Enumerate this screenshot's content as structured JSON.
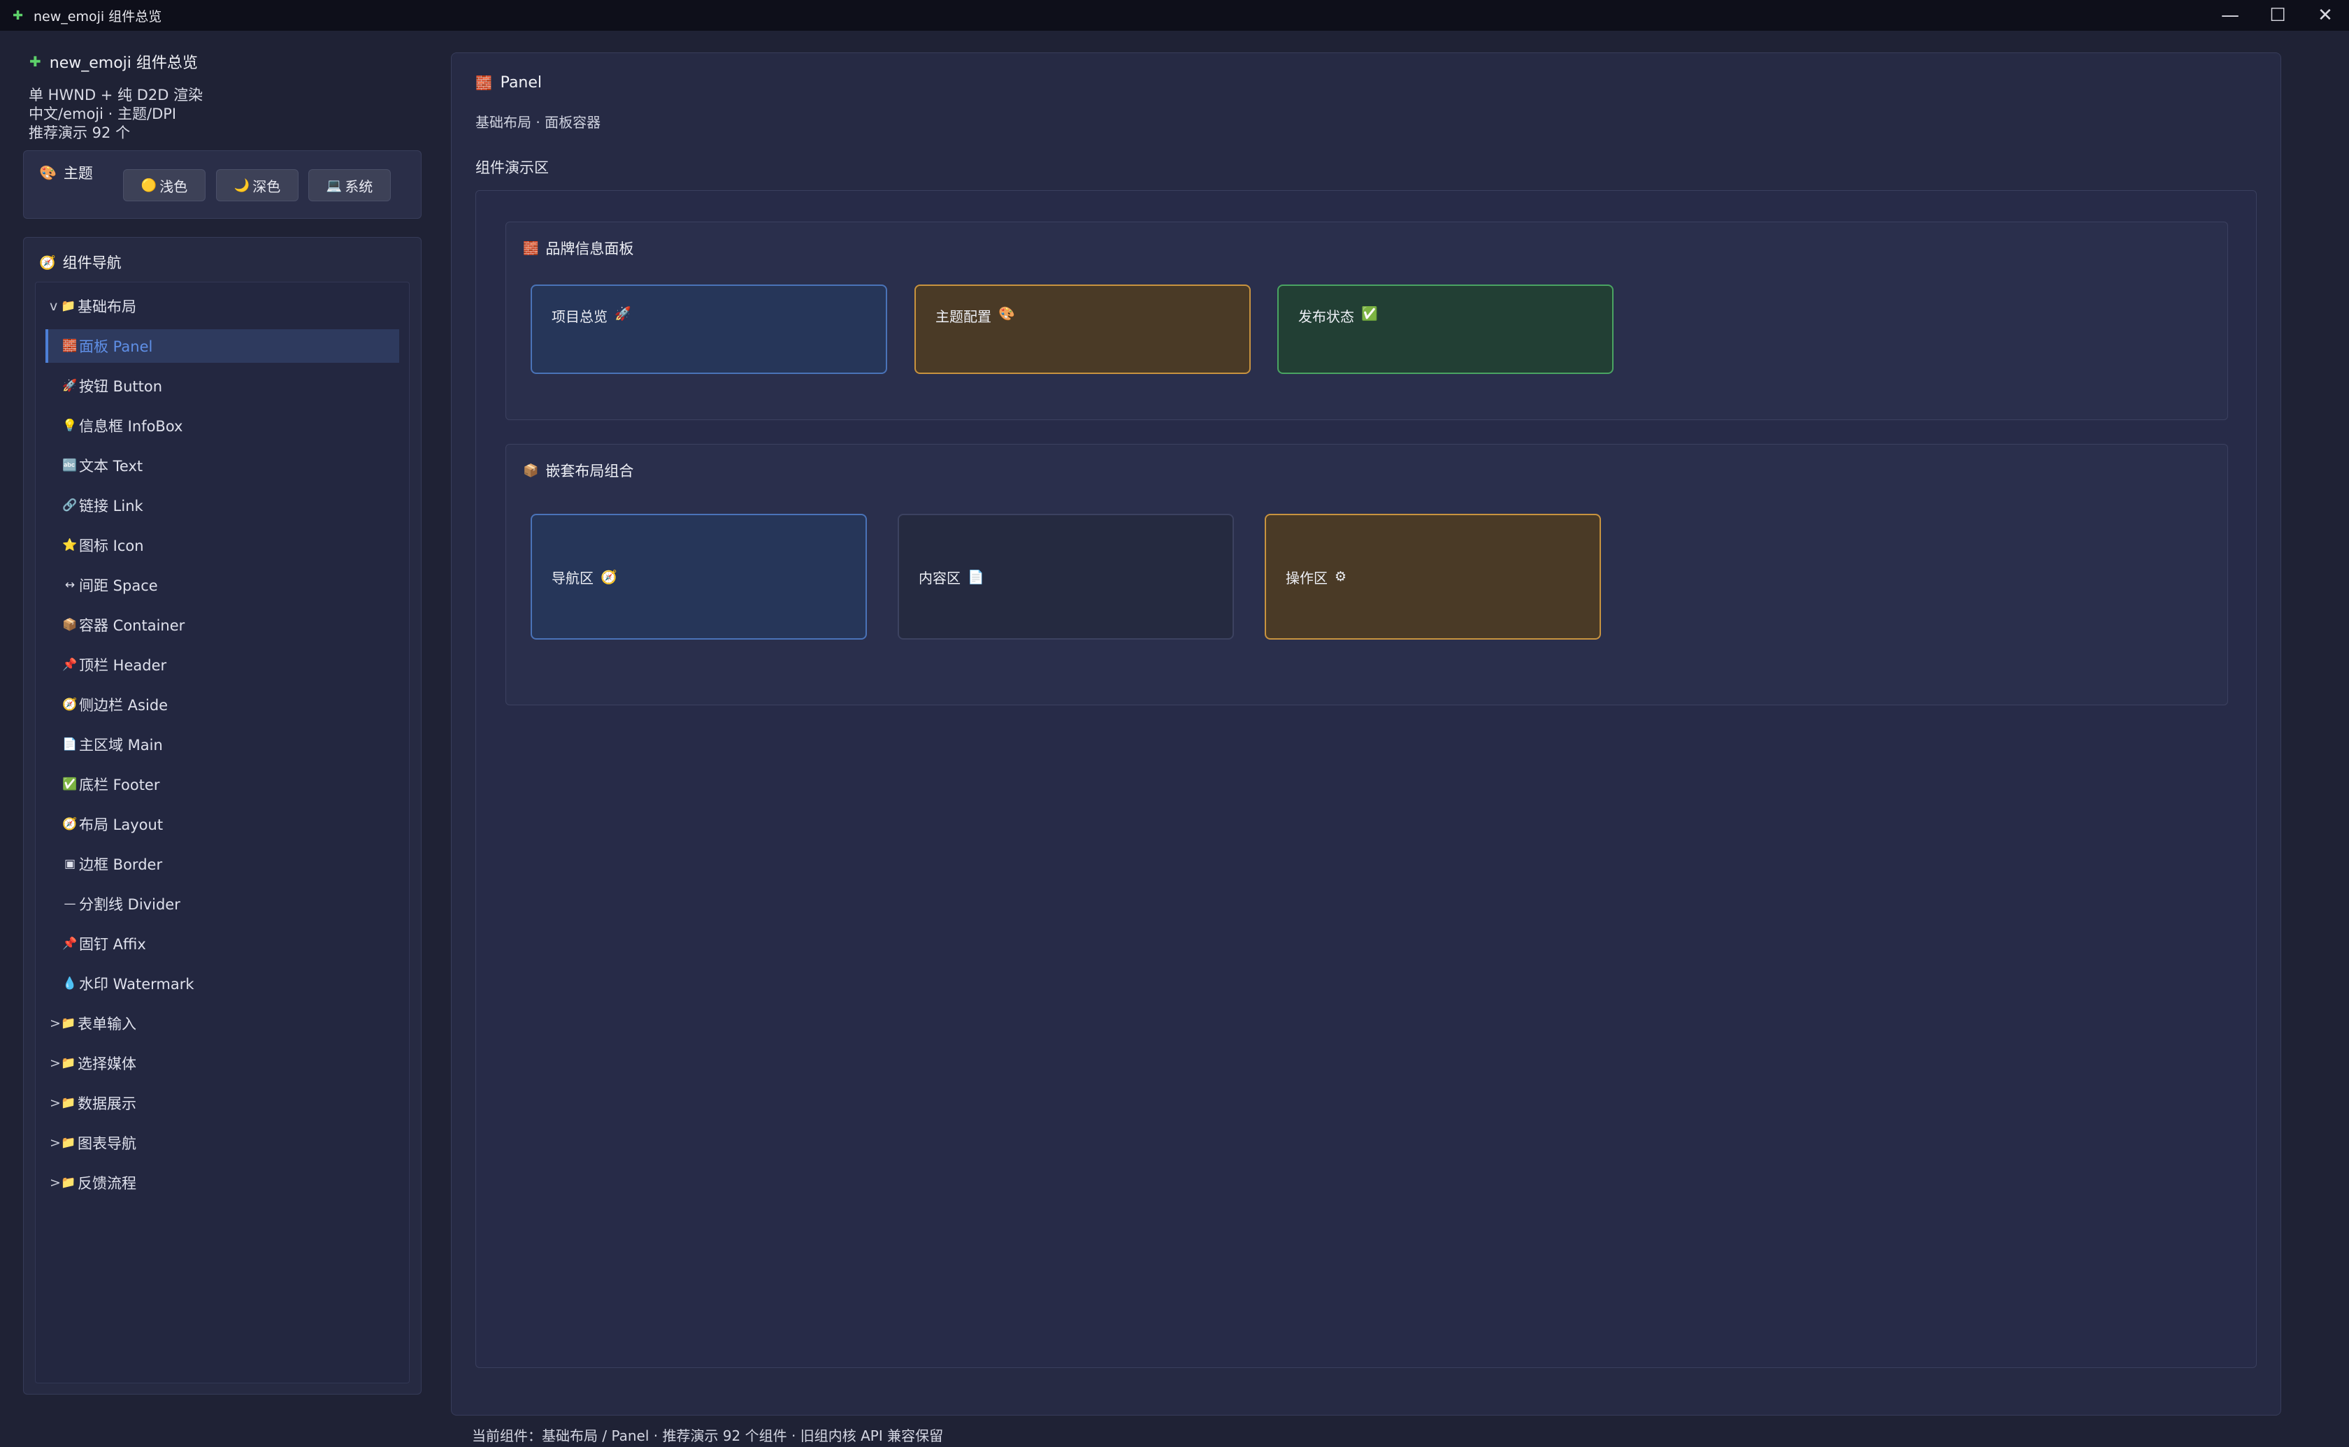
{
  "window": {
    "title": "new_emoji 组件总览",
    "icon": "puzzle-icon",
    "controls": {
      "minimize": "—",
      "maximize": "☐",
      "close": "✕"
    }
  },
  "sidebar": {
    "app_title": "new_emoji 组件总览",
    "app_icon": "puzzle-icon",
    "info_lines": [
      "单 HWND + 纯 D2D 渲染",
      "中文/emoji · 主题/DPI",
      "推荐演示 92 个"
    ],
    "theme": {
      "label": "主题",
      "icon": "palette-icon",
      "options": [
        {
          "label": "浅色",
          "icon": "🟡"
        },
        {
          "label": "深色",
          "icon": "🌙"
        },
        {
          "label": "系统",
          "icon": "💻"
        }
      ]
    },
    "nav": {
      "label": "组件导航",
      "icon": "compass-icon",
      "groups": [
        {
          "arrow": "v",
          "icon": "📁",
          "label": "基础布局"
        },
        {
          "arrow": ">",
          "icon": "📁",
          "label": "表单输入"
        },
        {
          "arrow": ">",
          "icon": "📁",
          "label": "选择媒体"
        },
        {
          "arrow": ">",
          "icon": "📁",
          "label": "数据展示"
        },
        {
          "arrow": ">",
          "icon": "📁",
          "label": "图表导航"
        },
        {
          "arrow": ">",
          "icon": "📁",
          "label": "反馈流程"
        }
      ],
      "items": [
        {
          "icon": "🧱",
          "label": "面板 Panel"
        },
        {
          "icon": "🚀",
          "label": "按钮 Button"
        },
        {
          "icon": "💡",
          "label": "信息框 InfoBox"
        },
        {
          "icon": "🔤",
          "label": "文本 Text"
        },
        {
          "icon": "🔗",
          "label": "链接 Link"
        },
        {
          "icon": "⭐",
          "label": "图标 Icon"
        },
        {
          "icon": "↔",
          "label": "间距 Space"
        },
        {
          "icon": "📦",
          "label": "容器 Container"
        },
        {
          "icon": "📌",
          "label": "顶栏 Header"
        },
        {
          "icon": "🧭",
          "label": "侧边栏 Aside"
        },
        {
          "icon": "📄",
          "label": "主区域 Main"
        },
        {
          "icon": "✅",
          "label": "底栏 Footer"
        },
        {
          "icon": "🧭",
          "label": "布局 Layout"
        },
        {
          "icon": "▣",
          "label": "边框 Border"
        },
        {
          "icon": "—",
          "label": "分割线 Divider"
        },
        {
          "icon": "📌",
          "label": "固钉 Affix"
        },
        {
          "icon": "💧",
          "label": "水印 Watermark"
        }
      ]
    }
  },
  "main": {
    "title": "Panel",
    "title_icon": "brick-icon",
    "subtitle": "基础布局 · 面板容器",
    "demo_label": "组件演示区",
    "brand_panel": {
      "title": "品牌信息面板",
      "icon": "🧱",
      "cards": [
        {
          "label": "项目总览",
          "icon": "🚀"
        },
        {
          "label": "主题配置",
          "icon": "🎨"
        },
        {
          "label": "发布状态",
          "icon": "✅"
        }
      ]
    },
    "nested_panel": {
      "title": "嵌套布局组合",
      "icon": "📦",
      "cards": [
        {
          "label": "导航区",
          "icon": "🧭"
        },
        {
          "label": "内容区",
          "icon": "📄"
        },
        {
          "label": "操作区",
          "icon": "⚙"
        }
      ]
    }
  },
  "status": {
    "text": "当前组件：基础布局 / Panel · 推荐演示 92 个组件 · 旧组内核 API 兼容保留"
  },
  "colors": {
    "accent": "#4d7fd6",
    "card_blue": "#4a73b8",
    "card_amber": "#c8933f",
    "card_green": "#4aa462"
  }
}
